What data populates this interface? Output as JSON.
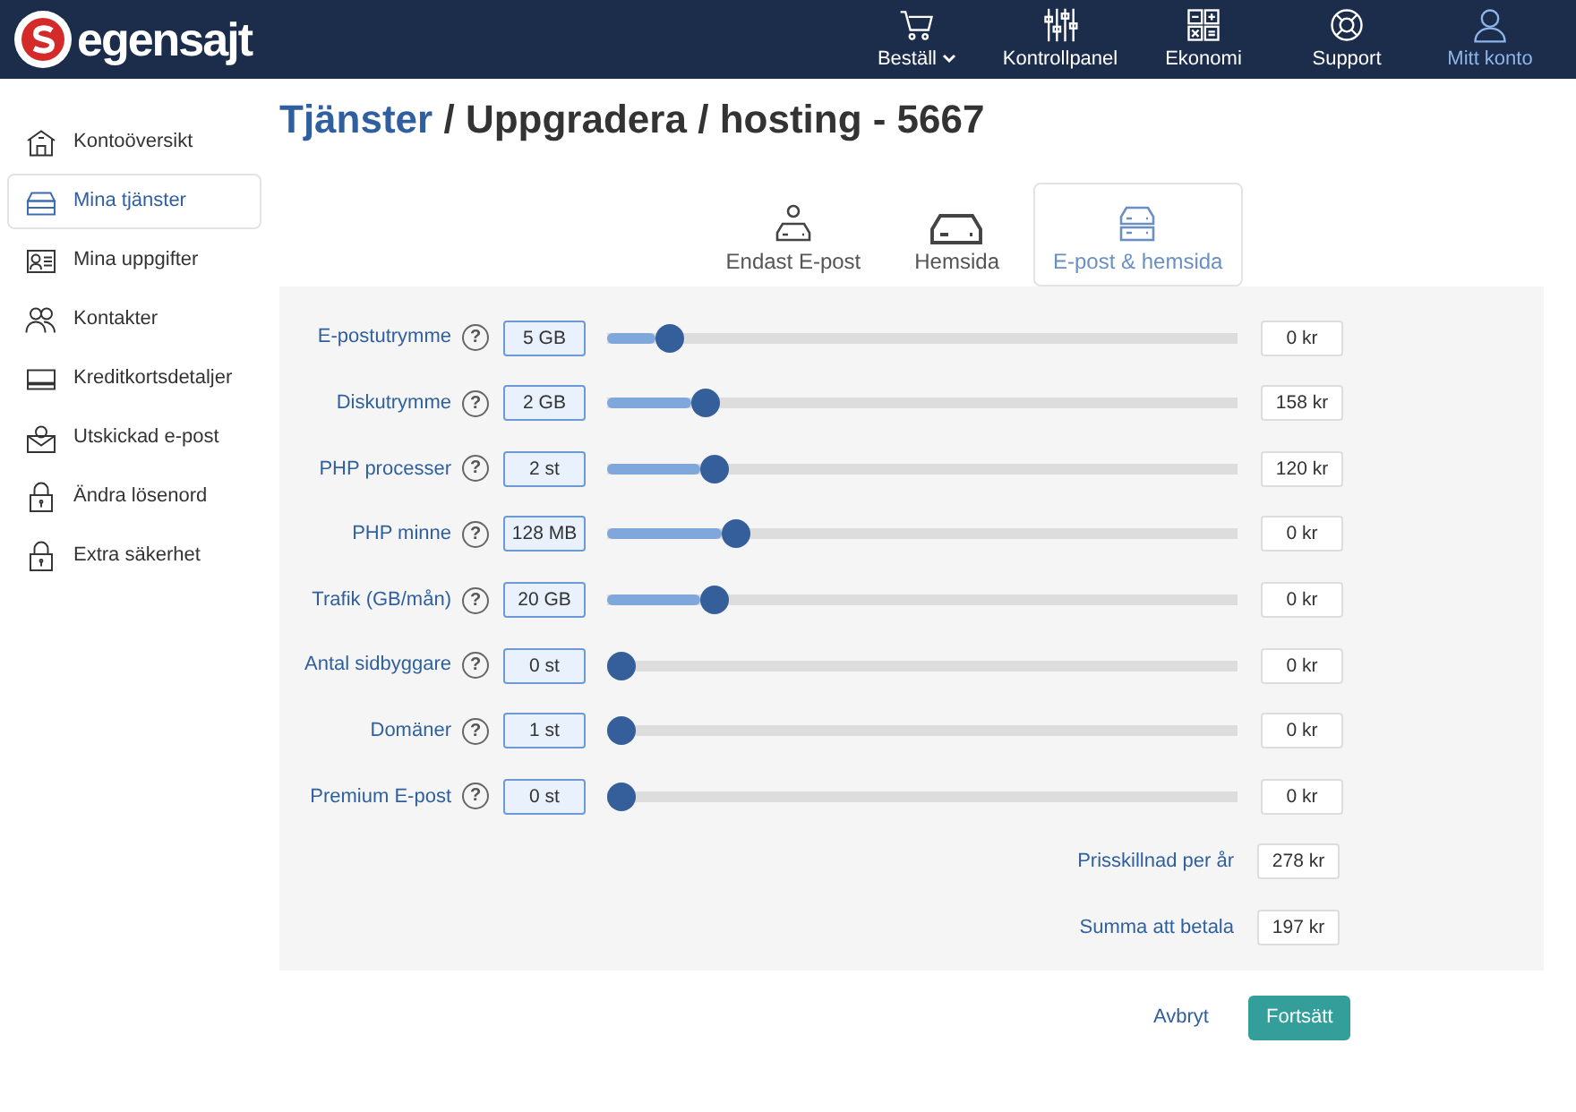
{
  "logo": {
    "text": "egensajt"
  },
  "nav": [
    {
      "label": "Beställ",
      "dropdown": true,
      "selected": false
    },
    {
      "label": "Kontrollpanel",
      "dropdown": false,
      "selected": false
    },
    {
      "label": "Ekonomi",
      "dropdown": false,
      "selected": false
    },
    {
      "label": "Support",
      "dropdown": false,
      "selected": false
    },
    {
      "label": "Mitt konto",
      "dropdown": false,
      "selected": true
    }
  ],
  "sidebar": {
    "items": [
      {
        "label": "Kontoöversikt",
        "selected": false
      },
      {
        "label": "Mina tjänster",
        "selected": true
      },
      {
        "label": "Mina uppgifter",
        "selected": false
      },
      {
        "label": "Kontakter",
        "selected": false
      },
      {
        "label": "Kreditkortsdetaljer",
        "selected": false
      },
      {
        "label": "Utskickad e-post",
        "selected": false
      },
      {
        "label": "Ändra lösenord",
        "selected": false
      },
      {
        "label": "Extra säkerhet",
        "selected": false
      }
    ]
  },
  "breadcrumb": [
    {
      "text": "Tjänster",
      "link": true
    },
    {
      "text": "/",
      "link": false
    },
    {
      "text": "Uppgradera",
      "link": false
    },
    {
      "text": "/",
      "link": false
    },
    {
      "text": "hosting - 5667",
      "link": false
    }
  ],
  "plans": [
    {
      "label": "Endast E-post",
      "selected": false
    },
    {
      "label": "Hemsida",
      "selected": false
    },
    {
      "label": "E-post & hemsida",
      "selected": true
    }
  ],
  "rows": [
    {
      "label": "E-postutrymme",
      "value": "5 GB",
      "level": 0.08,
      "price": "0 kr"
    },
    {
      "label": "Diskutrymme",
      "value": "2 GB",
      "level": 0.14,
      "price": "158 kr"
    },
    {
      "label": "PHP processer",
      "value": "2 st",
      "level": 0.155,
      "price": "120 kr"
    },
    {
      "label": "PHP minne",
      "value": "128 MB",
      "level": 0.19,
      "price": "0 kr"
    },
    {
      "label": "Trafik (GB/mån)",
      "value": "20 GB",
      "level": 0.155,
      "price": "0 kr"
    },
    {
      "label": "Antal sidbyggare",
      "value": "0 st",
      "level": 0,
      "price": "0 kr"
    },
    {
      "label": "Domäner",
      "value": "1 st",
      "level": 0,
      "price": "0 kr"
    },
    {
      "label": "Premium E-post",
      "value": "0 st",
      "level": 0,
      "price": "0 kr"
    }
  ],
  "help_icon": "?",
  "totals": [
    {
      "label": "Prisskillnad per år",
      "value": "278 kr"
    },
    {
      "label": "Summa att betala",
      "value": "197 kr"
    }
  ],
  "buttons": [
    {
      "label": "Avbryt",
      "kind": "link"
    },
    {
      "label": "Fortsätt",
      "kind": "primary"
    }
  ]
}
